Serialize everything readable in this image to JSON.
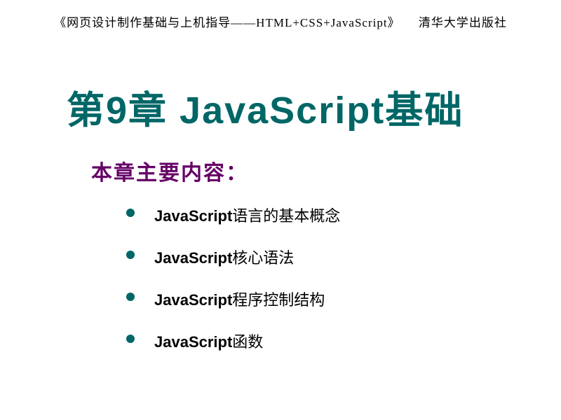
{
  "header": {
    "book_title": "《网页设计制作基础与上机指导——HTML+CSS+JavaScript》",
    "publisher": "清华大学出版社"
  },
  "chapter": {
    "title": "第9章 JavaScript基础"
  },
  "section": {
    "title": "本章主要内容："
  },
  "bullets": [
    {
      "bold": "JavaScript",
      "rest": "语言的基本概念"
    },
    {
      "bold": "JavaScript",
      "rest": "核心语法"
    },
    {
      "bold": "JavaScript",
      "rest": "程序控制结构"
    },
    {
      "bold": "JavaScript",
      "rest": "函数"
    }
  ]
}
